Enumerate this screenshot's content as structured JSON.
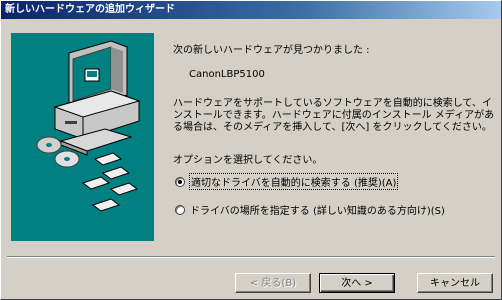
{
  "window": {
    "title": "新しいハードウェアの追加ウィザード"
  },
  "content": {
    "heading": "次の新しいハードウェアが見つかりました :",
    "device_name": "CanonLBP5100",
    "description": "ハードウェアをサポートしているソフトウェアを自動的に検索して、インストールできます。ハードウェアに付属のインストール メディアがある場合は、そのメディアを挿入して、[次へ] をクリックしてください。",
    "prompt": "オプションを選択してください。",
    "options": [
      {
        "label": "適切なドライバを自動的に検索する (推奨)(A)",
        "selected": true
      },
      {
        "label": "ドライバの場所を指定する (詳しい知識のある方向け)(S)",
        "selected": false
      }
    ]
  },
  "buttons": {
    "back": "< 戻る(B)",
    "next": "次へ >",
    "cancel": "キャンセル"
  },
  "colors": {
    "art_background": "#008080",
    "title_start": "#0a246a",
    "title_end": "#a6caf0"
  },
  "icons": [
    "computer-icon",
    "cd-disc-icon",
    "floppy-disk-icon"
  ]
}
